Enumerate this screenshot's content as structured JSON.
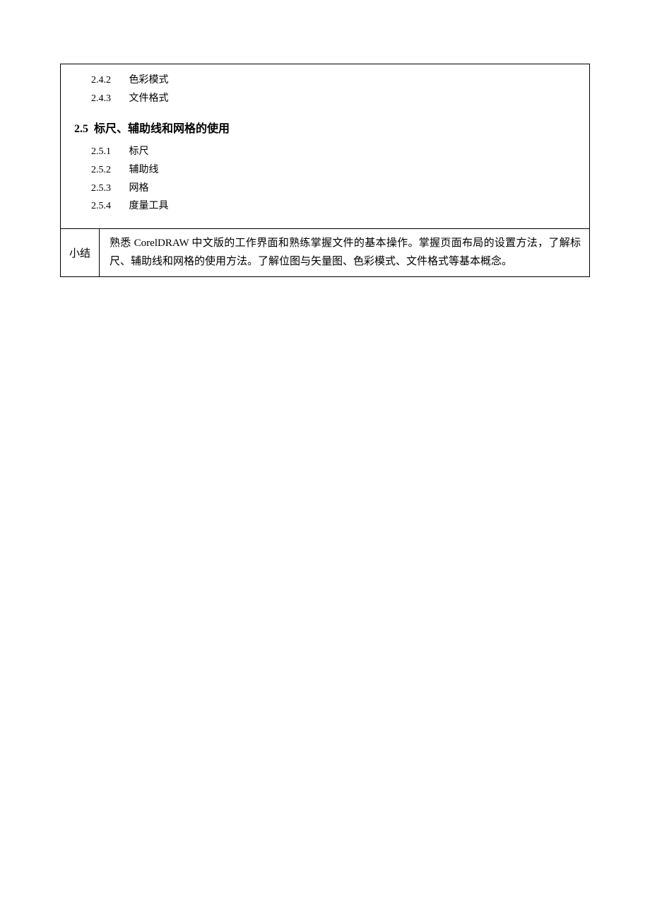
{
  "content": {
    "items24": [
      {
        "num": "2.4.2",
        "label": "色彩模式"
      },
      {
        "num": "2.4.3",
        "label": "文件格式"
      }
    ],
    "section25": {
      "num": "2.5",
      "title": "标尺、辅助线和网格的使用"
    },
    "items25": [
      {
        "num": "2.5.1",
        "label": "标尺"
      },
      {
        "num": "2.5.2",
        "label": "辅助线"
      },
      {
        "num": "2.5.3",
        "label": "网格"
      },
      {
        "num": "2.5.4",
        "label": "度量工具"
      }
    ]
  },
  "summary": {
    "label": "小结",
    "text": "熟悉 CorelDRAW 中文版的工作界面和熟练掌握文件的基本操作。掌握页面布局的设置方法，了解标尺、辅助线和网格的使用方法。了解位图与矢量图、色彩模式、文件格式等基本概念。"
  }
}
